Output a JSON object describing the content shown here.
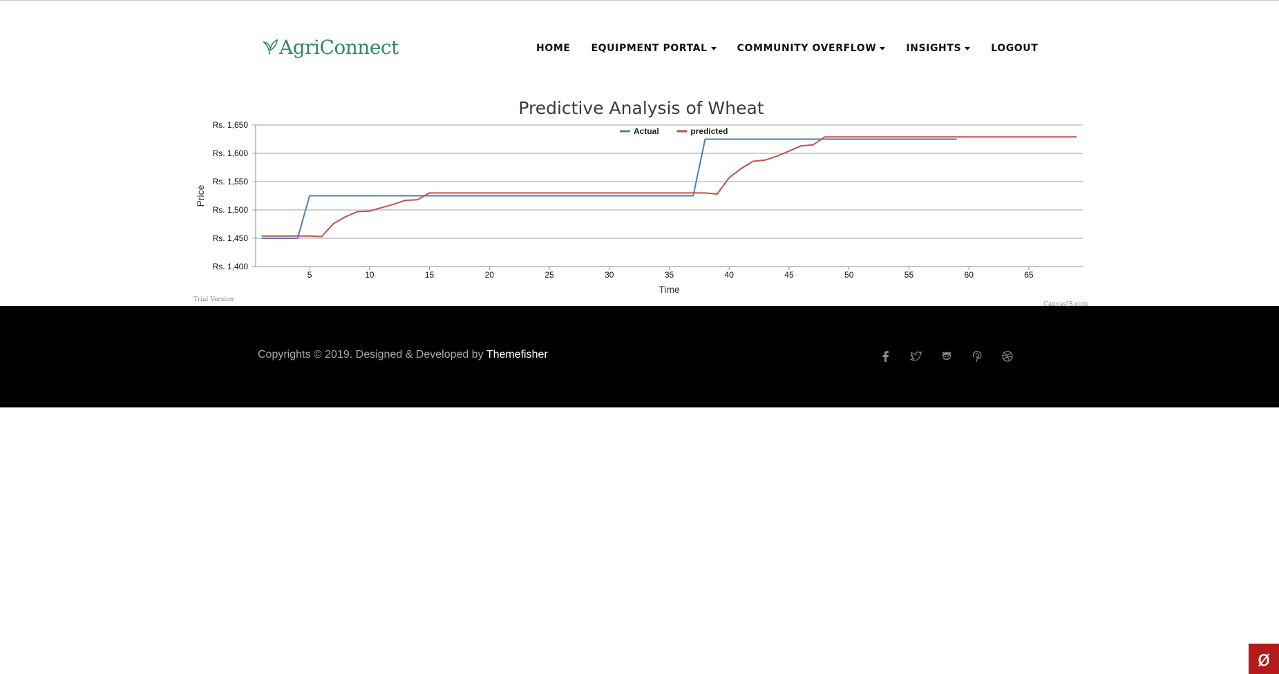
{
  "brand": {
    "name": "AgriConnect",
    "color": "#2f8a5f"
  },
  "nav": {
    "items": [
      {
        "label": "HOME",
        "dropdown": false
      },
      {
        "label": "EQUIPMENT PORTAL",
        "dropdown": true
      },
      {
        "label": "COMMUNITY OVERFLOW",
        "dropdown": true
      },
      {
        "label": "INSIGHTS",
        "dropdown": true
      },
      {
        "label": "LOGOUT",
        "dropdown": false
      }
    ]
  },
  "chart_data": {
    "type": "line",
    "title": "Predictive Analysis of Wheat",
    "xlabel": "Time",
    "ylabel": "Price",
    "ylim": [
      1400,
      1650
    ],
    "yticks": [
      1400,
      1450,
      1500,
      1550,
      1600,
      1650
    ],
    "ytick_labels": [
      "Rs. 1,400",
      "Rs. 1,450",
      "Rs. 1,500",
      "Rs. 1,550",
      "Rs. 1,600",
      "Rs. 1,650"
    ],
    "xlim": [
      0.5,
      69.5
    ],
    "xticks": [
      5,
      10,
      15,
      20,
      25,
      30,
      35,
      40,
      45,
      50,
      55,
      60,
      65
    ],
    "grid": true,
    "legend_position": "top-center",
    "series": [
      {
        "name": "Actual",
        "color": "#4a7ebb",
        "points": [
          [
            1,
            1450
          ],
          [
            4,
            1450
          ],
          [
            5,
            1525
          ],
          [
            37,
            1525
          ],
          [
            38,
            1625
          ],
          [
            59,
            1625
          ]
        ]
      },
      {
        "name": "predicted",
        "color": "#c0504d",
        "points": [
          [
            1,
            1454
          ],
          [
            5,
            1454
          ],
          [
            6,
            1453
          ],
          [
            7,
            1476
          ],
          [
            8,
            1488
          ],
          [
            9,
            1497
          ],
          [
            10,
            1498
          ],
          [
            11,
            1504
          ],
          [
            12,
            1510
          ],
          [
            13,
            1517
          ],
          [
            14,
            1518
          ],
          [
            15,
            1530
          ],
          [
            37,
            1530
          ],
          [
            38,
            1530
          ],
          [
            39,
            1528
          ],
          [
            40,
            1557
          ],
          [
            41,
            1573
          ],
          [
            42,
            1586
          ],
          [
            43,
            1588
          ],
          [
            44,
            1595
          ],
          [
            45,
            1604
          ],
          [
            46,
            1613
          ],
          [
            47,
            1615
          ],
          [
            48,
            1629
          ],
          [
            69,
            1629
          ]
        ]
      }
    ]
  },
  "watermark": {
    "trial": "Trial Version",
    "brand": "CanvasJS.com"
  },
  "footer": {
    "copyright": "Copyrights © 2019. Designed & Developed by",
    "link": "Themefisher",
    "social": [
      "facebook-icon",
      "twitter-icon",
      "github-icon",
      "pinterest-icon",
      "dribbble-icon"
    ]
  },
  "badge": {
    "symbol": "ø"
  }
}
